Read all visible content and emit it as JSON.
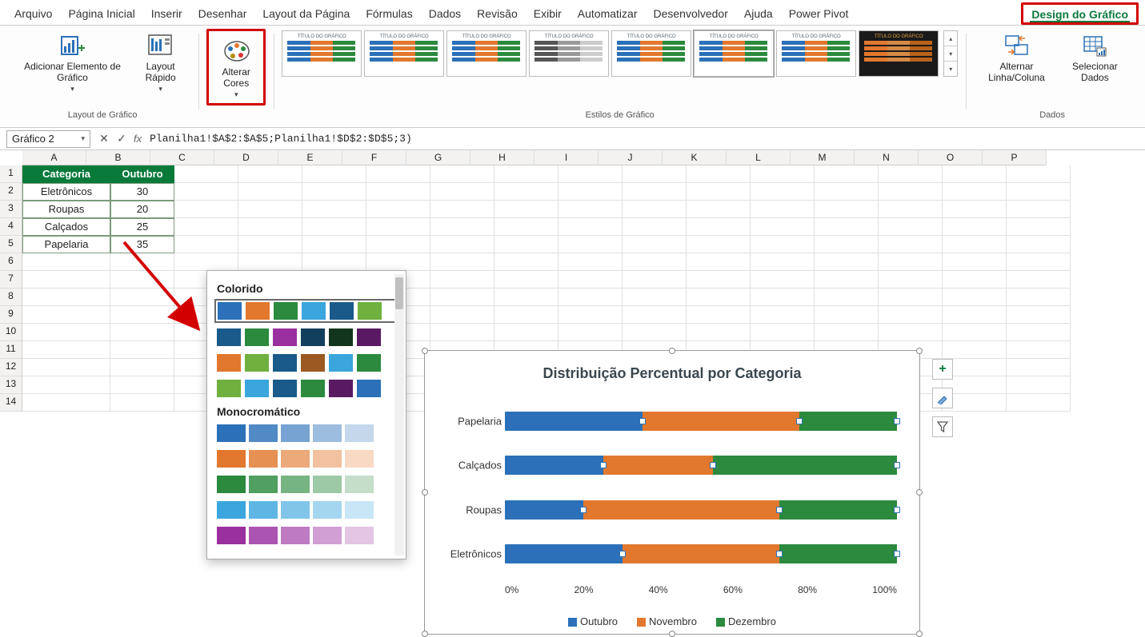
{
  "ribbon": {
    "tabs": [
      "Arquivo",
      "Página Inicial",
      "Inserir",
      "Desenhar",
      "Layout da Página",
      "Fórmulas",
      "Dados",
      "Revisão",
      "Exibir",
      "Automatizar",
      "Desenvolvedor",
      "Ajuda",
      "Power Pivot",
      "Design do Gráfico"
    ],
    "groups": {
      "layout": {
        "label": "Layout de Gráfico",
        "add_element": "Adicionar Elemento de Gráfico",
        "quick_layout": "Layout Rápido"
      },
      "colors_btn": "Alterar Cores",
      "styles_label": "Estilos de Gráfico",
      "data": {
        "label": "Dados",
        "switch": "Alternar Linha/Coluna",
        "select": "Selecionar Dados"
      }
    }
  },
  "name_box": "Gráfico 2",
  "formula": "Planilha1!$A$2:$A$5;Planilha1!$D$2:$D$5;3)",
  "columns": [
    "A",
    "B",
    "C",
    "D",
    "E",
    "F",
    "G",
    "H",
    "I",
    "J",
    "K",
    "L",
    "M",
    "N",
    "O",
    "P"
  ],
  "row_numbers": [
    "1",
    "2",
    "3",
    "4",
    "5",
    "6",
    "7",
    "8",
    "9",
    "10",
    "11",
    "12",
    "13",
    "14"
  ],
  "table": {
    "headers": {
      "cat": "Categoria",
      "oct": "Outubro"
    },
    "rows": [
      {
        "cat": "Eletrônicos",
        "val": "30"
      },
      {
        "cat": "Roupas",
        "val": "20"
      },
      {
        "cat": "Calçados",
        "val": "25"
      },
      {
        "cat": "Papelaria",
        "val": "35"
      }
    ]
  },
  "color_dropdown": {
    "section1": "Colorido",
    "section2": "Monocromático"
  },
  "chart_data": {
    "type": "bar",
    "title": "Distribuição Percentual por Categoria",
    "stacked": "percent",
    "orientation": "horizontal",
    "categories": [
      "Papelaria",
      "Calçados",
      "Roupas",
      "Eletrônicos"
    ],
    "series": [
      {
        "name": "Outubro",
        "color": "#2b70b8",
        "values": [
          35,
          25,
          20,
          30
        ]
      },
      {
        "name": "Novembro",
        "color": "#e2782e",
        "values": [
          40,
          28,
          50,
          40
        ]
      },
      {
        "name": "Dezembro",
        "color": "#2b8a3e",
        "values": [
          25,
          47,
          30,
          30
        ]
      }
    ],
    "xlabel": "",
    "ylabel": "",
    "xaxis_ticks": [
      "0%",
      "20%",
      "40%",
      "60%",
      "80%",
      "100%"
    ],
    "legend_position": "bottom"
  }
}
